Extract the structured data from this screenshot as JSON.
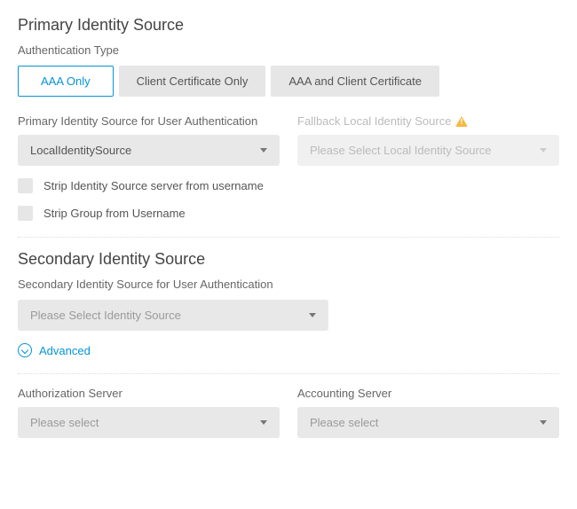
{
  "primary": {
    "header": "Primary Identity Source",
    "auth_type_label": "Authentication Type",
    "tabs": {
      "aaa": "AAA Only",
      "cert": "Client Certificate Only",
      "both": "AAA and Client Certificate"
    },
    "source_label": "Primary Identity Source for User Authentication",
    "source_value": "LocalIdentitySource",
    "fallback_label": "Fallback Local Identity Source",
    "fallback_placeholder": "Please Select Local Identity Source",
    "strip_server": "Strip Identity Source server from username",
    "strip_group": "Strip Group from Username"
  },
  "secondary": {
    "header": "Secondary Identity Source",
    "source_label": "Secondary Identity Source for User Authentication",
    "source_placeholder": "Please Select Identity Source",
    "advanced": "Advanced"
  },
  "servers": {
    "authz_label": "Authorization Server",
    "authz_placeholder": "Please select",
    "acct_label": "Accounting Server",
    "acct_placeholder": "Please select"
  }
}
